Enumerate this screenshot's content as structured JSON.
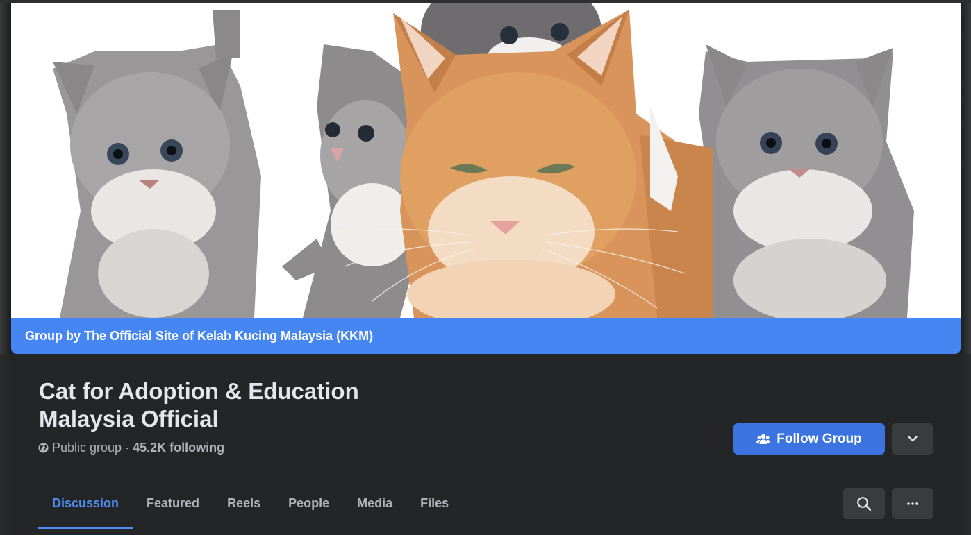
{
  "group": {
    "owner_bar": "Group by The Official Site of Kelab Kucing Malaysia (KKM)",
    "title": "Cat for Adoption & Education Malaysia Official",
    "privacy": "Public group",
    "separator": "·",
    "following": "45.2K following"
  },
  "actions": {
    "follow_label": "Follow Group",
    "follow_icon": "people-icon",
    "dropdown_icon": "chevron-down-icon"
  },
  "tabs": [
    {
      "label": "Discussion",
      "active": true
    },
    {
      "label": "Featured",
      "active": false
    },
    {
      "label": "Reels",
      "active": false
    },
    {
      "label": "People",
      "active": false
    },
    {
      "label": "Media",
      "active": false
    },
    {
      "label": "Files",
      "active": false
    }
  ],
  "toolbar": {
    "search_icon": "search-icon",
    "more_icon": "more-horizontal-icon"
  },
  "colors": {
    "accent": "#4686f3",
    "follow_button": "#3b74e0",
    "active_tab": "#4f8ef5",
    "panel": "#242526"
  }
}
